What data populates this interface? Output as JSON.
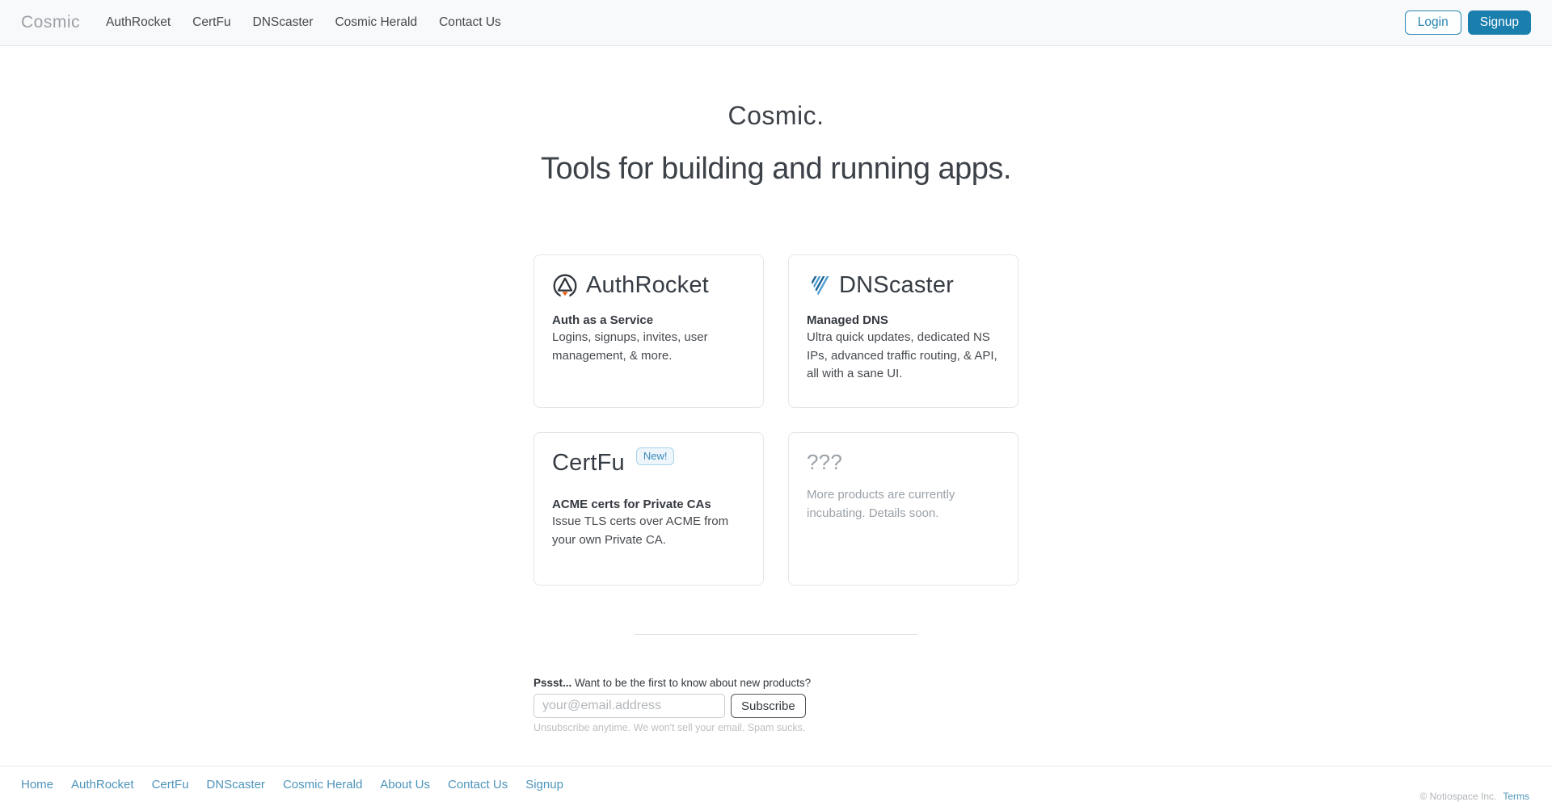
{
  "navbar": {
    "brand": "Cosmic",
    "links": [
      {
        "label": "AuthRocket"
      },
      {
        "label": "CertFu"
      },
      {
        "label": "DNScaster"
      },
      {
        "label": "Cosmic Herald"
      },
      {
        "label": "Contact Us"
      }
    ],
    "login_label": "Login",
    "signup_label": "Signup"
  },
  "hero": {
    "title": "Cosmic.",
    "subtitle": "Tools for building and running apps."
  },
  "cards": [
    {
      "title": "AuthRocket",
      "icon": "authrocket-logo-icon",
      "tagline": "Auth as a Service",
      "description": "Logins, signups, invites, user management, & more."
    },
    {
      "title": "DNScaster",
      "icon": "dnscaster-logo-icon",
      "tagline": "Managed DNS",
      "description": "Ultra quick updates, dedicated NS IPs, advanced traffic routing, & API, all with a sane UI."
    },
    {
      "title": "CertFu",
      "badge": "New!",
      "tagline": "ACME certs for Private CAs",
      "description": "Issue TLS certs over ACME from your own Private CA."
    },
    {
      "title": "???",
      "description": "More products are currently incubating. Details soon."
    }
  ],
  "newsletter": {
    "prompt_bold": "Pssst...",
    "prompt_rest": " Want to be the first to know about new products?",
    "email_placeholder": "your@email.address",
    "email_value": "",
    "subscribe_label": "Subscribe",
    "fine_print": "Unsubscribe anytime. We won't sell your email. Spam sucks."
  },
  "footer": {
    "links": [
      {
        "label": "Home"
      },
      {
        "label": "AuthRocket"
      },
      {
        "label": "CertFu"
      },
      {
        "label": "DNScaster"
      },
      {
        "label": "Cosmic Herald"
      },
      {
        "label": "About Us"
      },
      {
        "label": "Contact Us"
      },
      {
        "label": "Signup"
      }
    ],
    "copyright": "© Notiospace Inc.",
    "terms_label": "Terms"
  },
  "colors": {
    "accent_blue": "#1b7fae",
    "link_blue": "#4d94bb",
    "authrocket_orange": "#eb5b16",
    "dnscaster_blue": "#1d6498",
    "badge_blue": "#3a8ab8",
    "navbar_bg": "#f8f9fa",
    "muted_gray": "#9aa1a8"
  }
}
